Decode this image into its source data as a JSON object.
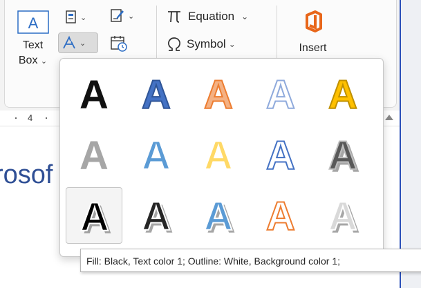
{
  "ribbon": {
    "text_box": {
      "line1": "Text",
      "line2": "Box",
      "caret": "⌄"
    },
    "equation_label": "Equation",
    "symbol_label": "Symbol",
    "insert_label": "Insert"
  },
  "ruler": {
    "number": "4"
  },
  "document": {
    "visible_text": "rosof"
  },
  "wordart": {
    "letter": "A",
    "styles": [
      {
        "row": 0,
        "col": 0,
        "fill": "#111111",
        "stroke": "none",
        "shadow": false,
        "selected": false
      },
      {
        "row": 0,
        "col": 1,
        "fill": "#4472c4",
        "stroke": "#2f5597",
        "shadow": false,
        "selected": false
      },
      {
        "row": 0,
        "col": 2,
        "fill": "#f4b183",
        "stroke": "#ed7d31",
        "shadow": false,
        "selected": false
      },
      {
        "row": 0,
        "col": 3,
        "fill": "#ffffff",
        "stroke": "#8faadc",
        "shadow": false,
        "selected": false
      },
      {
        "row": 0,
        "col": 4,
        "fill": "#ffc000",
        "stroke": "#bf9000",
        "shadow": false,
        "selected": false
      },
      {
        "row": 1,
        "col": 0,
        "fill": "#a6a6a6",
        "stroke": "none",
        "shadow": false,
        "selected": false
      },
      {
        "row": 1,
        "col": 1,
        "fill": "#5b9bd5",
        "stroke": "#ffffff",
        "shadow": false,
        "selected": false
      },
      {
        "row": 1,
        "col": 2,
        "fill": "#ffd966",
        "stroke": "#ffffff",
        "shadow": false,
        "selected": false
      },
      {
        "row": 1,
        "col": 3,
        "fill": "#ffffff",
        "stroke": "#4472c4",
        "shadow": false,
        "selected": false
      },
      {
        "row": 1,
        "col": 4,
        "fill": "#595959",
        "stroke": "#bfbfbf",
        "shadow": true,
        "selected": false
      },
      {
        "row": 2,
        "col": 0,
        "fill": "#000000",
        "stroke": "#ffffff",
        "shadow": true,
        "selected": true
      },
      {
        "row": 2,
        "col": 1,
        "fill": "#262626",
        "stroke": "#ffffff",
        "shadow": true,
        "selected": false
      },
      {
        "row": 2,
        "col": 2,
        "fill": "#5b9bd5",
        "stroke": "#ffffff",
        "shadow": true,
        "selected": false
      },
      {
        "row": 2,
        "col": 3,
        "fill": "#ffffff",
        "stroke": "#ed7d31",
        "shadow": false,
        "selected": false
      },
      {
        "row": 2,
        "col": 4,
        "fill": "#d9d9d9",
        "stroke": "#ffffff",
        "shadow": true,
        "selected": false
      }
    ]
  },
  "tooltip": {
    "text": "Fill: Black, Text color 1; Outline: White, Background color 1;"
  },
  "colors": {
    "accent_blue": "#2a4fb8",
    "icon_blue": "#2b6cc4",
    "insert_orange": "#e8661a"
  }
}
